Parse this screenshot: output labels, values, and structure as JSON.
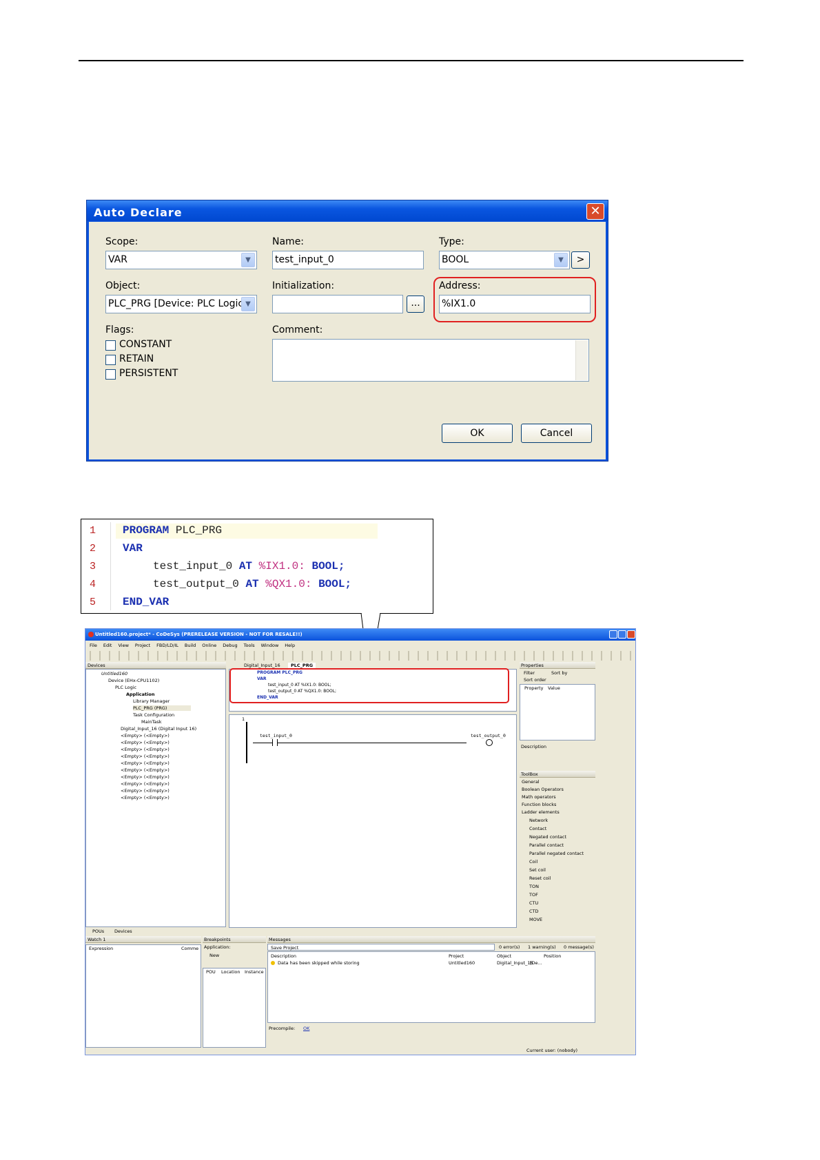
{
  "dialog": {
    "title": "Auto Declare",
    "close_symbol": "✕",
    "scope_label": "Scope:",
    "scope_value": "VAR",
    "name_label": "Name:",
    "name_value": "test_input_0",
    "type_label": "Type:",
    "type_value": "BOOL",
    "type_button": ">",
    "object_label": "Object:",
    "object_value": "PLC_PRG [Device: PLC Logic: /",
    "init_label": "Initialization:",
    "init_value": "",
    "init_button": "...",
    "address_label": "Address:",
    "address_value": "%IX1.0",
    "flags_label": "Flags:",
    "flags": [
      "CONSTANT",
      "RETAIN",
      "PERSISTENT"
    ],
    "comment_label": "Comment:",
    "comment_value": "",
    "ok": "OK",
    "cancel": "Cancel",
    "dropdown_symbol": "▼"
  },
  "code": {
    "line_numbers": [
      "1",
      "2",
      "3",
      "4",
      "5"
    ],
    "kw_program": "PROGRAM",
    "prog_name": "PLC_PRG",
    "kw_var": "VAR",
    "l3_name": "test_input_0",
    "l3_at": "AT",
    "l3_addr": "%IX1.0:",
    "l3_type": "BOOL;",
    "l4_name": "test_output_0",
    "l4_at": "AT",
    "l4_addr": "%QX1.0:",
    "l4_type": "BOOL;",
    "kw_endvar": "END_VAR"
  },
  "ide": {
    "title": "Untitled160.project* - CoDeSys (PRERELEASE VERSION - NOT FOR RESALE!!)",
    "menu": [
      "File",
      "Edit",
      "View",
      "Project",
      "FBD/LD/IL",
      "Build",
      "Online",
      "Debug",
      "Tools",
      "Window",
      "Help"
    ],
    "devices_title": "Devices",
    "tree": [
      "Untitled160",
      "Device (EHx-CPU1102)",
      "PLC Logic",
      "Application",
      "Library Manager",
      "PLC_PRG (PRG)",
      "Task Configuration",
      "MainTask",
      "Digital_Input_16 (Digital Input 16)",
      "<Empty> (<Empty>)",
      "<Empty> (<Empty>)",
      "<Empty> (<Empty>)",
      "<Empty> (<Empty>)",
      "<Empty> (<Empty>)",
      "<Empty> (<Empty>)",
      "<Empty> (<Empty>)",
      "<Empty> (<Empty>)",
      "<Empty> (<Empty>)",
      "<Empty> (<Empty>)"
    ],
    "tabs": [
      "Digital_Input_16",
      "PLC_PRG"
    ],
    "mini_code": [
      "PROGRAM PLC_PRG",
      "VAR",
      "test_input_0 AT %IX1.0: BOOL;",
      "test_output_0 AT %QX1.0: BOOL;",
      "END_VAR"
    ],
    "network_number": "1",
    "contact_label": "test_input_0",
    "coil_label": "test_output_0",
    "bottom_tabs": [
      "POUs",
      "Devices"
    ],
    "properties": {
      "title": "Properties",
      "filter": "Filter",
      "sort_by": "Sort by",
      "sort_order": "Sort order",
      "col_property": "Property",
      "col_value": "Value",
      "description": "Description"
    },
    "toolbox": {
      "title": "ToolBox",
      "groups": [
        "General",
        "Boolean Operators",
        "Math operators",
        "Function blocks",
        "Ladder elements"
      ],
      "items": [
        "Network",
        "Contact",
        "Negated contact",
        "Parallel contact",
        "Parallel negated contact",
        "Coil",
        "Set coil",
        "Reset coil",
        "TON",
        "TOF",
        "CTU",
        "CTD",
        "MOVE"
      ]
    },
    "watch": {
      "title": "Watch 1",
      "col_expression": "Expression",
      "col_comment": "Comme"
    },
    "breakpoints": {
      "title": "Breakpoints",
      "application": "Application:",
      "new": "New",
      "col_pou": "POU",
      "col_location": "Location",
      "col_instance": "Instance"
    },
    "messages": {
      "title": "Messages",
      "filter_value": "Save Project",
      "errors": "0 error(s)",
      "warnings": "1 warning(s)",
      "msgs": "0 message(s)",
      "col_description": "Description",
      "col_project": "Project",
      "col_object": "Object",
      "col_position": "Position",
      "row_description": "Data has been skipped while storing",
      "row_project": "Untitled160",
      "row_object": "Digital_Input_16",
      "row_position": "[De...",
      "precompile_label": "Precompile:",
      "precompile_value": "OK"
    },
    "status": "Current user: (nobody)",
    "colors": {
      "accent": "#e02020",
      "titlebar": "#0a52dc"
    }
  }
}
